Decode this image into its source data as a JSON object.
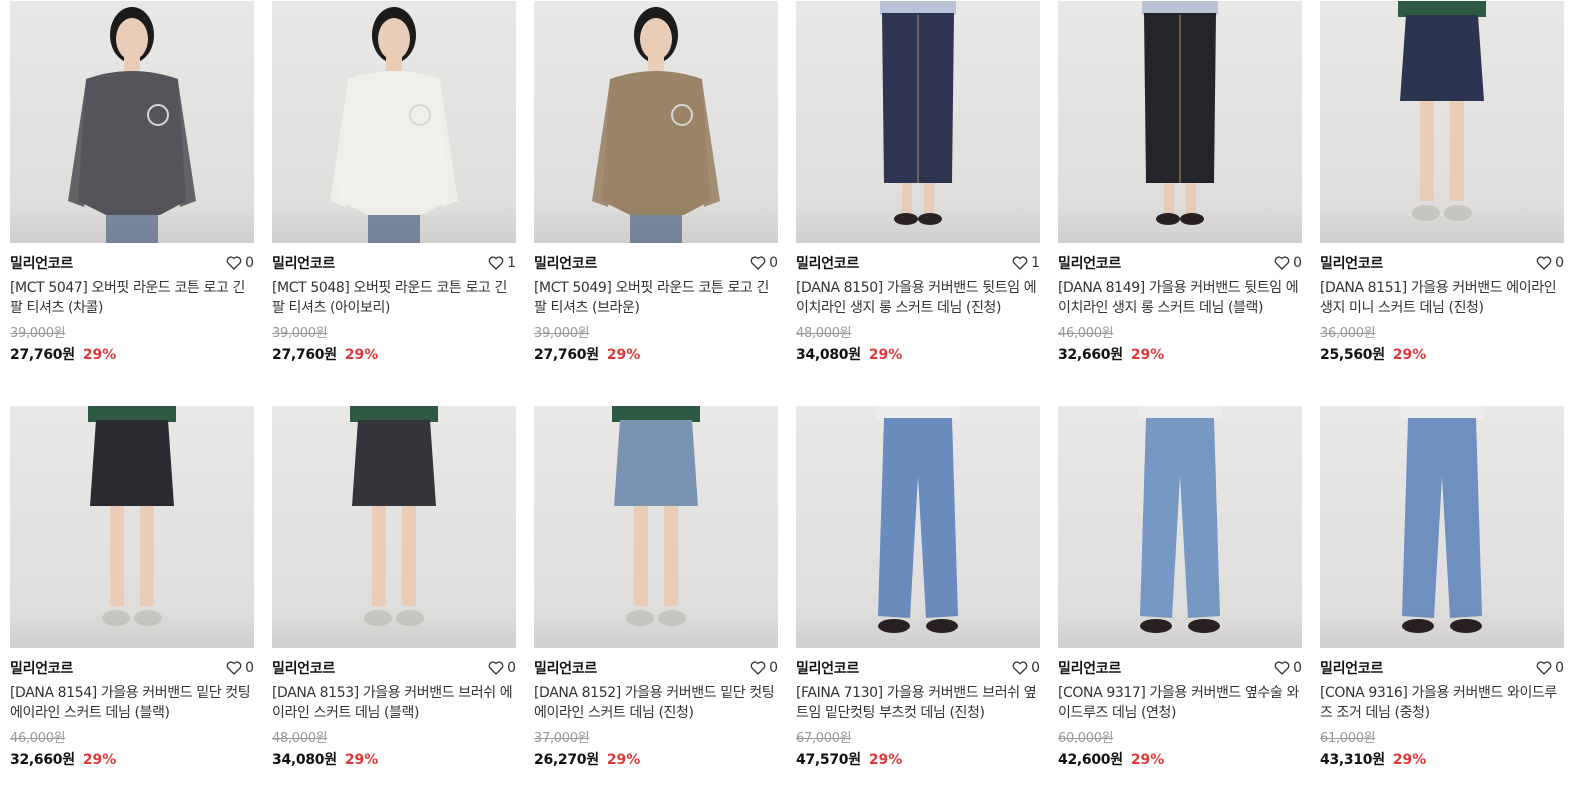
{
  "products": [
    {
      "brand": "밀리언코르",
      "likes": "0",
      "title": "[MCT 5047] 오버핏 라운드 코튼 로고 긴팔 티셔츠 (차콜)",
      "original_price": "39,000원",
      "price": "27,760원",
      "discount": "29%",
      "garment": "top",
      "color": "#55545a",
      "icon": "model-photo"
    },
    {
      "brand": "밀리언코르",
      "likes": "1",
      "title": "[MCT 5048] 오버핏 라운드 코튼 로고 긴팔 티셔츠 (아이보리)",
      "original_price": "39,000원",
      "price": "27,760원",
      "discount": "29%",
      "garment": "top",
      "color": "#f1efea",
      "icon": "model-photo"
    },
    {
      "brand": "밀리언코르",
      "likes": "0",
      "title": "[MCT 5049] 오버핏 라운드 코튼 로고 긴팔 티셔츠 (브라운)",
      "original_price": "39,000원",
      "price": "27,760원",
      "discount": "29%",
      "garment": "top",
      "color": "#9a8468",
      "icon": "model-photo"
    },
    {
      "brand": "밀리언코르",
      "likes": "1",
      "title": "[DANA 8150] 가을용 커버밴드 뒷트임 에이치라인 생지 롱 스커트 데님 (진청)",
      "original_price": "48,000원",
      "price": "34,080원",
      "discount": "29%",
      "garment": "long-skirt",
      "color": "#2d3550",
      "icon": "model-photo"
    },
    {
      "brand": "밀리언코르",
      "likes": "0",
      "title": "[DANA 8149] 가을용 커버밴드 뒷트임 에이치라인 생지 롱 스커트 데님 (블랙)",
      "original_price": "46,000원",
      "price": "32,660원",
      "discount": "29%",
      "garment": "long-skirt",
      "color": "#23252b",
      "icon": "model-photo"
    },
    {
      "brand": "밀리언코르",
      "likes": "0",
      "title": "[DANA 8151] 가을용 커버밴드 에이라인 생지 미니 스커트 데님 (진청)",
      "original_price": "36,000원",
      "price": "25,560원",
      "discount": "29%",
      "garment": "mini-skirt",
      "color": "#2b3450",
      "icon": "model-photo"
    },
    {
      "brand": "밀리언코르",
      "likes": "0",
      "title": "[DANA 8154] 가을용 커버밴드 밑단 컷팅 에이라인 스커트 데님 (블랙)",
      "original_price": "46,000원",
      "price": "32,660원",
      "discount": "29%",
      "garment": "mini-skirt",
      "color": "#2a2b30",
      "icon": "model-photo"
    },
    {
      "brand": "밀리언코르",
      "likes": "0",
      "title": "[DANA 8153] 가을용 커버밴드 브러쉬 에이라인 스커트 데님 (블랙)",
      "original_price": "48,000원",
      "price": "34,080원",
      "discount": "29%",
      "garment": "mini-skirt",
      "color": "#34353b",
      "icon": "model-photo"
    },
    {
      "brand": "밀리언코르",
      "likes": "0",
      "title": "[DANA 8152] 가을용 커버밴드 밑단 컷팅 에이라인 스커트 데님 (진청)",
      "original_price": "37,000원",
      "price": "26,270원",
      "discount": "29%",
      "garment": "mini-skirt",
      "color": "#7a93b3",
      "icon": "model-photo"
    },
    {
      "brand": "밀리언코르",
      "likes": "0",
      "title": "[FAINA 7130] 가을용 커버밴드 브러쉬 옆트임 밑단컷팅 부츠컷 데님 (진청)",
      "original_price": "67,000원",
      "price": "47,570원",
      "discount": "29%",
      "garment": "pants",
      "color": "#6a8bbd",
      "icon": "model-photo"
    },
    {
      "brand": "밀리언코르",
      "likes": "0",
      "title": "[CONA 9317] 가을용 커버밴드 옆수술 와이드루즈 데님 (연청)",
      "original_price": "60,000원",
      "price": "42,600원",
      "discount": "29%",
      "garment": "pants",
      "color": "#7898c4",
      "icon": "model-photo"
    },
    {
      "brand": "밀리언코르",
      "likes": "0",
      "title": "[CONA 9316] 가을용 커버밴드 와이드루즈 조거 데님 (중청)",
      "original_price": "61,000원",
      "price": "43,310원",
      "discount": "29%",
      "garment": "pants",
      "color": "#6f8fbf",
      "icon": "model-photo"
    }
  ],
  "like_icon": "heart-outline-icon"
}
